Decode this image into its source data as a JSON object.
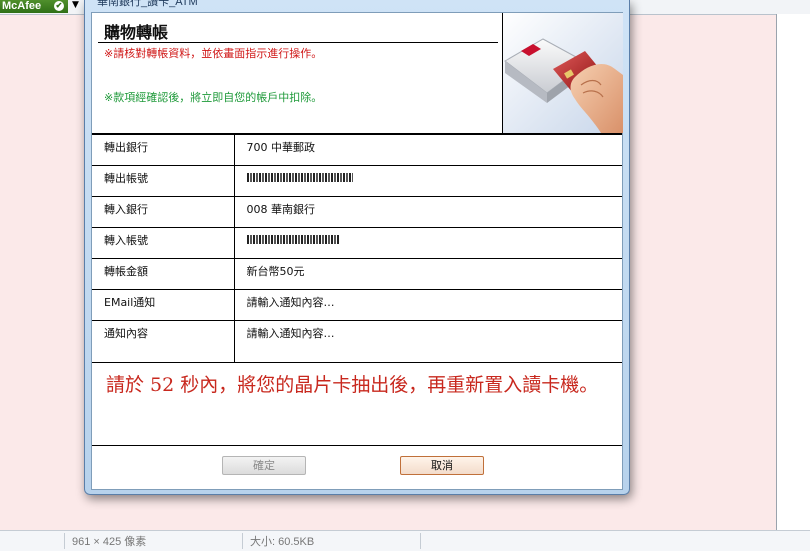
{
  "window": {
    "title": "華南銀行_讀卡_ATM"
  },
  "header": {
    "title": "購物轉帳",
    "notice_review": "※請核對轉帳資料，並依畫面指示進行操作。",
    "notice_deduct": "※款項經確認後，將立即自您的帳戶中扣除。"
  },
  "rows": [
    {
      "label": "轉出銀行",
      "value": "700 中華郵政"
    },
    {
      "label": "轉出帳號",
      "value": ""
    },
    {
      "label": "轉入銀行",
      "value": "008 華南銀行"
    },
    {
      "label": "轉入帳號",
      "value": ""
    },
    {
      "label": "轉帳金額",
      "value": "新台幣50元"
    },
    {
      "label": "EMail通知",
      "value": "請輸入通知內容…"
    },
    {
      "label": "通知內容",
      "value": "請輸入通知內容…"
    }
  ],
  "countdown_message": "請於 52 秒內，將您的晶片卡抽出後，再重新置入讀卡機。",
  "buttons": {
    "confirm": "確定",
    "cancel": "取消"
  },
  "browser": {
    "toolbar_logo": "McAfee",
    "status_dimensions": "961 × 425 像素",
    "status_size": "大小: 60.5KB"
  },
  "colors": {
    "notice_red": "#d01818",
    "notice_green": "#1f9a3a",
    "countdown_red": "#c8281e"
  }
}
